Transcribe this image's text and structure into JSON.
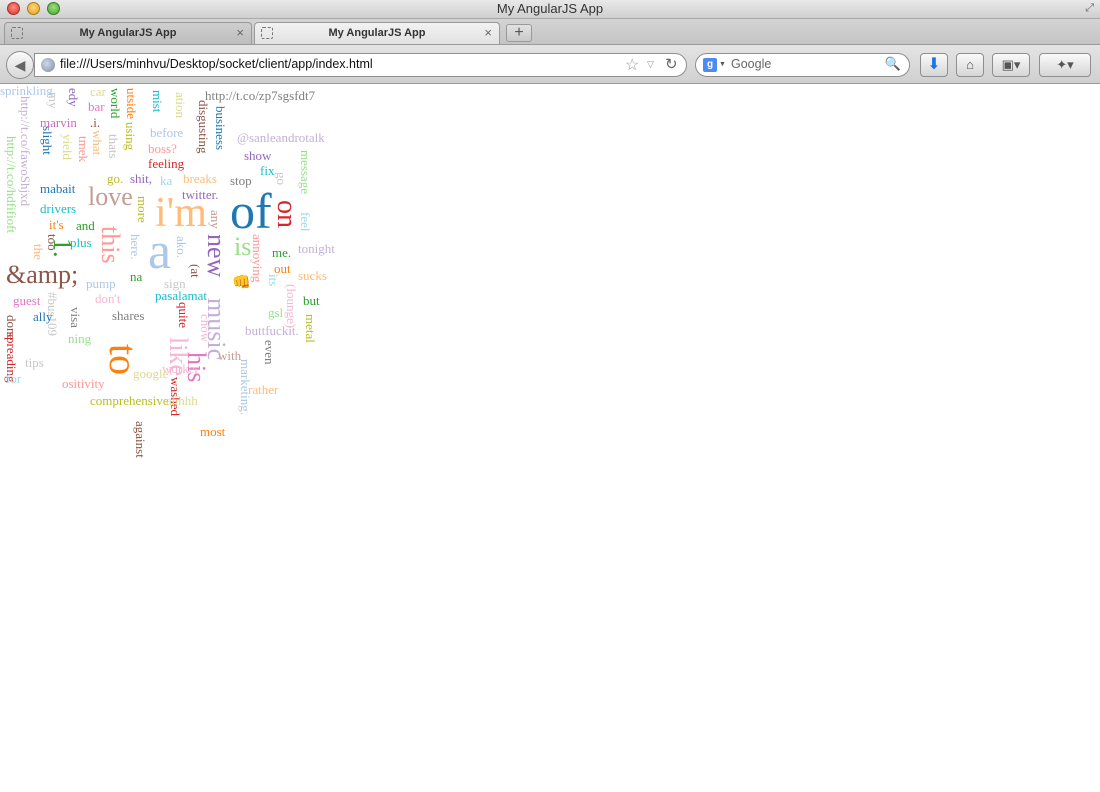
{
  "window": {
    "title": "My AngularJS App"
  },
  "tabs": [
    {
      "label": "My AngularJS App",
      "active": false
    },
    {
      "label": "My AngularJS App",
      "active": true
    }
  ],
  "navbar": {
    "url": "file:///Users/minhvu/Desktop/socket/client/app/index.html",
    "search_placeholder": "Google",
    "search_engine_letter": "g"
  },
  "icons": {
    "close_tab": "×",
    "new_tab": "+",
    "back": "◀",
    "bookmark_star": "☆",
    "dropdown": "▽",
    "reload": "↻",
    "search": "🔍",
    "download": "⬇",
    "home": "⌂",
    "bookmarks_menu": "▣▾",
    "extension": "✦▾",
    "fullscreen": "⤢"
  },
  "wordcloud": [
    {
      "text": "http://t.co/zp7sgsfdt7",
      "size": 13,
      "color": "#7f7f7f",
      "rot": 0
    },
    {
      "text": "car",
      "size": 13,
      "color": "#dbdb8d",
      "rot": 0
    },
    {
      "text": "edy",
      "size": 13,
      "color": "#9467bd",
      "rot": 90
    },
    {
      "text": "bar",
      "size": 13,
      "color": "#e377c2",
      "rot": 0
    },
    {
      "text": ".i.",
      "size": 13,
      "color": "#8c564b",
      "rot": 0
    },
    {
      "text": "my",
      "size": 13,
      "color": "#c7c7c7",
      "rot": 90
    },
    {
      "text": "marvin",
      "size": 13,
      "color": "#ce6dbd",
      "rot": 0
    },
    {
      "text": "world",
      "size": 13,
      "color": "#2ca02c",
      "rot": 90
    },
    {
      "text": "utside",
      "size": 13,
      "color": "#ff7f0e",
      "rot": 90
    },
    {
      "text": "mist",
      "size": 13,
      "color": "#17becf",
      "rot": 90
    },
    {
      "text": "ation",
      "size": 13,
      "color": "#dbdb8d",
      "rot": 90
    },
    {
      "text": "disgusting",
      "size": 13,
      "color": "#8c564b",
      "rot": 90
    },
    {
      "text": "business",
      "size": 13,
      "color": "#1f77b4",
      "rot": 90
    },
    {
      "text": "using",
      "size": 13,
      "color": "#bcbd22",
      "rot": 90
    },
    {
      "text": "before",
      "size": 13,
      "color": "#aec7e8",
      "rot": 0
    },
    {
      "text": "@sanleandrotalk",
      "size": 13,
      "color": "#c5b0d5",
      "rot": 0
    },
    {
      "text": "http://t.co/fawoShjxd",
      "size": 13,
      "color": "#c5b0d5",
      "rot": 90
    },
    {
      "text": "http://t.co/hdfifioft",
      "size": 13,
      "color": "#98df8a",
      "rot": 90
    },
    {
      "text": "slight",
      "size": 13,
      "color": "#1f77b4",
      "rot": 90
    },
    {
      "text": "yield",
      "size": 13,
      "color": "#dbdb8d",
      "rot": 90
    },
    {
      "text": "what",
      "size": 13,
      "color": "#ffbb78",
      "rot": 90
    },
    {
      "text": "thats",
      "size": 13,
      "color": "#c7c7c7",
      "rot": 90
    },
    {
      "text": "tmek",
      "size": 13,
      "color": "#ff9896",
      "rot": 90
    },
    {
      "text": "boss?",
      "size": 13,
      "color": "#ff9896",
      "rot": 0
    },
    {
      "text": "feeling",
      "size": 13,
      "color": "#d62728",
      "rot": 0
    },
    {
      "text": "show",
      "size": 13,
      "color": "#9467bd",
      "rot": 0
    },
    {
      "text": "fix",
      "size": 13,
      "color": "#17becf",
      "rot": 0
    },
    {
      "text": "message",
      "size": 13,
      "color": "#98df8a",
      "rot": 90
    },
    {
      "text": "go.",
      "size": 13,
      "color": "#bcbd22",
      "rot": 0
    },
    {
      "text": "shit,",
      "size": 13,
      "color": "#9467bd",
      "rot": 0
    },
    {
      "text": "ka",
      "size": 13,
      "color": "#9edae5",
      "rot": 0
    },
    {
      "text": "breaks",
      "size": 13,
      "color": "#ffbb78",
      "rot": 0
    },
    {
      "text": "stop",
      "size": 13,
      "color": "#7f7f7f",
      "rot": 0
    },
    {
      "text": "go",
      "size": 13,
      "color": "#c7c7c7",
      "rot": 90
    },
    {
      "text": "mabait",
      "size": 13,
      "color": "#1f77b4",
      "rot": 0
    },
    {
      "text": "love",
      "size": 26,
      "color": "#c49c94",
      "rot": 0
    },
    {
      "text": "twitter.",
      "size": 13,
      "color": "#9467bd",
      "rot": 0
    },
    {
      "text": "drivers",
      "size": 13,
      "color": "#17becf",
      "rot": 0
    },
    {
      "text": "more",
      "size": 13,
      "color": "#bcbd22",
      "rot": 90
    },
    {
      "text": "i'm",
      "size": 42,
      "color": "#ffbb78",
      "rot": 0
    },
    {
      "text": "any",
      "size": 13,
      "color": "#c49c94",
      "rot": 90
    },
    {
      "text": "of",
      "size": 50,
      "color": "#1f77b4",
      "rot": 0
    },
    {
      "text": "on",
      "size": 28,
      "color": "#d62728",
      "rot": 90
    },
    {
      "text": "feel",
      "size": 13,
      "color": "#9edae5",
      "rot": 90
    },
    {
      "text": "it's",
      "size": 13,
      "color": "#ff7f0e",
      "rot": 0
    },
    {
      "text": "and",
      "size": 13,
      "color": "#2ca02c",
      "rot": 0
    },
    {
      "text": "this",
      "size": 26,
      "color": "#ff9896",
      "rot": 90
    },
    {
      "text": "plus",
      "size": 13,
      "color": "#17becf",
      "rot": 0
    },
    {
      "text": "too",
      "size": 13,
      "color": "#8c564b",
      "rot": 90
    },
    {
      "text": "1.",
      "size": 26,
      "color": "#2ca02c",
      "rot": 90
    },
    {
      "text": "the",
      "size": 13,
      "color": "#ffbb78",
      "rot": 90
    },
    {
      "text": "here.",
      "size": 13,
      "color": "#aec7e8",
      "rot": 90
    },
    {
      "text": "a",
      "size": 52,
      "color": "#aec7e8",
      "rot": 0
    },
    {
      "text": "ako.",
      "size": 13,
      "color": "#aec7e8",
      "rot": 90
    },
    {
      "text": "new",
      "size": 26,
      "color": "#9467bd",
      "rot": 90
    },
    {
      "text": "is",
      "size": 26,
      "color": "#98df8a",
      "rot": 0
    },
    {
      "text": "annoying",
      "size": 13,
      "color": "#ff9896",
      "rot": 90
    },
    {
      "text": "me.",
      "size": 13,
      "color": "#2ca02c",
      "rot": 0
    },
    {
      "text": "tonight",
      "size": 13,
      "color": "#c5b0d5",
      "rot": 0
    },
    {
      "text": "out",
      "size": 13,
      "color": "#ff7f0e",
      "rot": 0
    },
    {
      "text": "sucks",
      "size": 13,
      "color": "#ffbb78",
      "rot": 0
    },
    {
      "text": "&amp;",
      "size": 26,
      "color": "#8c564b",
      "rot": 0
    },
    {
      "text": "na",
      "size": 13,
      "color": "#2ca02c",
      "rot": 0
    },
    {
      "text": "pump",
      "size": 13,
      "color": "#aec7e8",
      "rot": 0
    },
    {
      "text": "sign",
      "size": 13,
      "color": "#c7c7c7",
      "rot": 0
    },
    {
      "text": "(at",
      "size": 13,
      "color": "#8c564b",
      "rot": 90
    },
    {
      "text": "👊",
      "size": 15,
      "color": "#f7b267",
      "rot": 0
    },
    {
      "text": "its",
      "size": 13,
      "color": "#9edae5",
      "rot": 90
    },
    {
      "text": "(lounge)",
      "size": 13,
      "color": "#f7b6d2",
      "rot": 90
    },
    {
      "text": "but",
      "size": 13,
      "color": "#2ca02c",
      "rot": 0
    },
    {
      "text": "guest",
      "size": 13,
      "color": "#e377c2",
      "rot": 0
    },
    {
      "text": "#bus109",
      "size": 13,
      "color": "#c7c7c7",
      "rot": 90
    },
    {
      "text": "don't",
      "size": 13,
      "color": "#f7b6d2",
      "rot": 0
    },
    {
      "text": "music",
      "size": 26,
      "color": "#c5b0d5",
      "rot": 90
    },
    {
      "text": "pasalamat",
      "size": 13,
      "color": "#17becf",
      "rot": 0
    },
    {
      "text": "quite",
      "size": 13,
      "color": "#d62728",
      "rot": 90
    },
    {
      "text": "done",
      "size": 13,
      "color": "#8c564b",
      "rot": 90
    },
    {
      "text": "ally",
      "size": 13,
      "color": "#1f77b4",
      "rot": 0
    },
    {
      "text": "visa",
      "size": 13,
      "color": "#7f7f7f",
      "rot": 90
    },
    {
      "text": "shares",
      "size": 13,
      "color": "#7f7f7f",
      "rot": 0
    },
    {
      "text": "chow",
      "size": 13,
      "color": "#f7b6d2",
      "rot": 90
    },
    {
      "text": "gsl",
      "size": 13,
      "color": "#98df8a",
      "rot": 0
    },
    {
      "text": "metal",
      "size": 13,
      "color": "#bcbd22",
      "rot": 90
    },
    {
      "text": "spreading",
      "size": 13,
      "color": "#d62728",
      "rot": 90
    },
    {
      "text": "ning",
      "size": 13,
      "color": "#98df8a",
      "rot": 0
    },
    {
      "text": "to",
      "size": 40,
      "color": "#ff7f0e",
      "rot": 90
    },
    {
      "text": "like",
      "size": 26,
      "color": "#f7b6d2",
      "rot": 90
    },
    {
      "text": "buttfuckit.",
      "size": 13,
      "color": "#c5b0d5",
      "rot": 0
    },
    {
      "text": "even",
      "size": 13,
      "color": "#7f7f7f",
      "rot": 90
    },
    {
      "text": "his",
      "size": 26,
      "color": "#e377c2",
      "rot": 90
    },
    {
      "text": "with",
      "size": 13,
      "color": "#c49c94",
      "rot": 0
    },
    {
      "text": "marketing.",
      "size": 13,
      "color": "#aec7e8",
      "rot": 90
    },
    {
      "text": "tips",
      "size": 13,
      "color": "#c7c7c7",
      "rot": 0
    },
    {
      "text": "worker",
      "size": 13,
      "color": "#f7b6d2",
      "rot": 0
    },
    {
      "text": "for",
      "size": 13,
      "color": "#9edae5",
      "rot": 0
    },
    {
      "text": "ositivity",
      "size": 13,
      "color": "#ff9896",
      "rot": 0
    },
    {
      "text": "google",
      "size": 13,
      "color": "#dbdb8d",
      "rot": 0
    },
    {
      "text": "washed",
      "size": 13,
      "color": "#d62728",
      "rot": 90
    },
    {
      "text": "rather",
      "size": 13,
      "color": "#ffbb78",
      "rot": 0
    },
    {
      "text": "comprehensive",
      "size": 13,
      "color": "#bcbd22",
      "rot": 0
    },
    {
      "text": "ahhhh",
      "size": 13,
      "color": "#dbdb8d",
      "rot": 0
    },
    {
      "text": "against",
      "size": 13,
      "color": "#8c564b",
      "rot": 90
    },
    {
      "text": "most",
      "size": 13,
      "color": "#ff7f0e",
      "rot": 0
    },
    {
      "text": "sprinkling",
      "size": 13,
      "color": "#aec7e8",
      "rot": 0
    }
  ]
}
